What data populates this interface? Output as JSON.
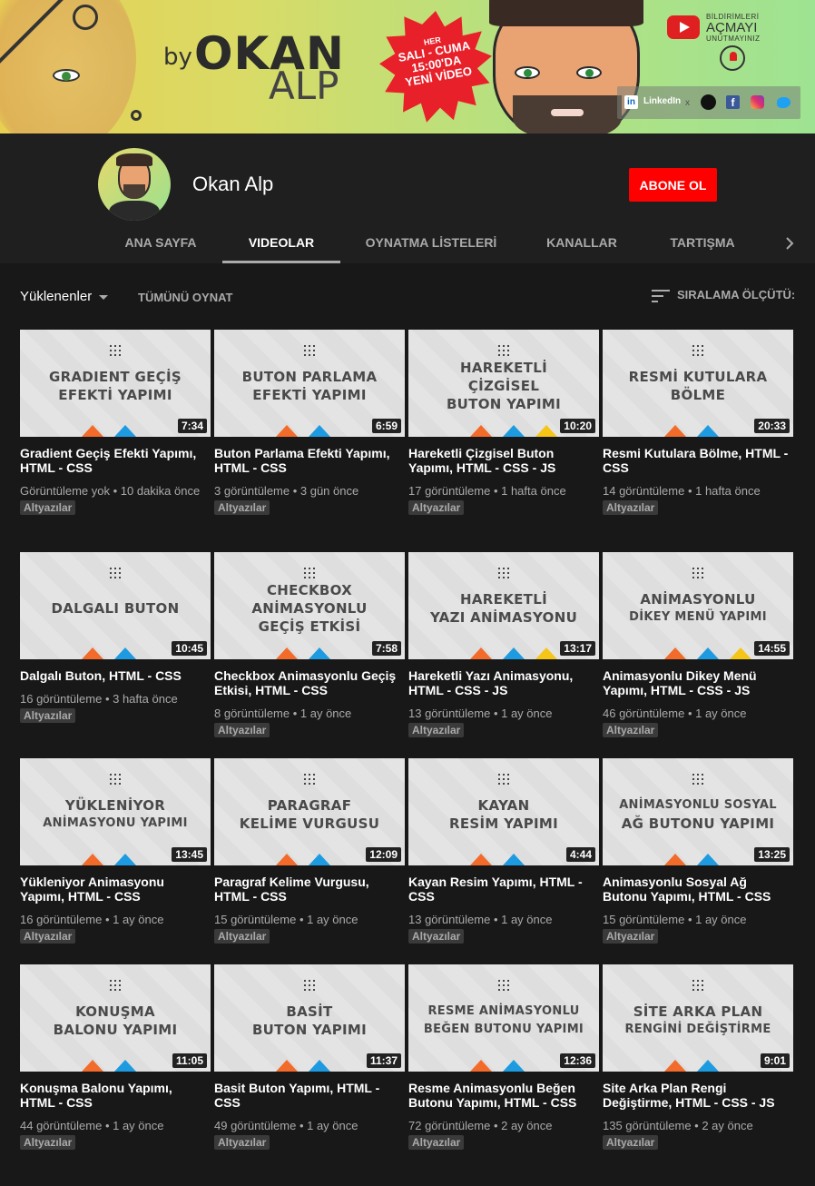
{
  "banner": {
    "by": "by",
    "name_first": "OKAN",
    "name_last": "ALP",
    "promo": [
      "HER",
      "SALI - CUMA",
      "15:00'DA",
      "YENİ VİDEO"
    ],
    "notify_top": "BİLDİRİMLERİ",
    "notify_mid": "AÇMAYI",
    "notify_bottom": "UNUTMAYINIZ",
    "social": {
      "linkedin": "LinkedIn",
      "x": "x"
    }
  },
  "channel": {
    "name": "Okan Alp",
    "subscribe_label": "ABONE OL"
  },
  "tabs": [
    {
      "label": "ANA SAYFA",
      "active": false
    },
    {
      "label": "VIDEOLAR",
      "active": true
    },
    {
      "label": "OYNATMA LİSTELERİ",
      "active": false
    },
    {
      "label": "KANALLAR",
      "active": false
    },
    {
      "label": "TARTIŞMA",
      "active": false
    }
  ],
  "filter": {
    "uploads_label": "Yüklenenler",
    "play_all_label": "TÜMÜNÜ OYNAT",
    "sort_label": "SIRALAMA ÖLÇÜTÜ:"
  },
  "videos": [
    {
      "thumb": [
        "GRADIENT GEÇİŞ",
        "EFEKTİ YAPIMI"
      ],
      "duration": "7:34",
      "title": "Gradient Geçiş Efekti Yapımı, HTML - CSS",
      "meta": "Görüntüleme yok • 10 dakika önce",
      "badge": "Altyazılar",
      "yellow": false
    },
    {
      "thumb": [
        "BUTON PARLAMA",
        "EFEKTİ YAPIMI"
      ],
      "duration": "6:59",
      "title": "Buton Parlama Efekti Yapımı, HTML - CSS",
      "meta": "3 görüntüleme • 3 gün önce",
      "badge": "Altyazılar",
      "yellow": false
    },
    {
      "thumb": [
        "HAREKETLİ",
        "ÇİZGİSEL",
        "BUTON YAPIMI"
      ],
      "duration": "10:20",
      "title": "Hareketli Çizgisel Buton Yapımı, HTML - CSS - JS",
      "meta": "17 görüntüleme • 1 hafta önce",
      "badge": "Altyazılar",
      "yellow": true
    },
    {
      "thumb": [
        "RESMİ KUTULARA",
        "BÖLME"
      ],
      "duration": "20:33",
      "title": "Resmi Kutulara Bölme, HTML - CSS",
      "meta": "14 görüntüleme • 1 hafta önce",
      "badge": "Altyazılar",
      "yellow": false
    },
    {
      "thumb": [
        "DALGALI BUTON"
      ],
      "duration": "10:45",
      "title": "Dalgalı Buton, HTML - CSS",
      "meta": "16 görüntüleme • 3 hafta önce",
      "badge": "Altyazılar",
      "yellow": false
    },
    {
      "thumb": [
        "CHECKBOX",
        "ANİMASYONLU",
        "GEÇİŞ ETKİSİ"
      ],
      "duration": "7:58",
      "title": "Checkbox Animasyonlu Geçiş Etkisi, HTML - CSS",
      "meta": "8 görüntüleme • 1 ay önce",
      "badge": "Altyazılar",
      "yellow": false
    },
    {
      "thumb": [
        "HAREKETLİ",
        "YAZI ANİMASYONU"
      ],
      "duration": "13:17",
      "title": "Hareketli Yazı Animasyonu, HTML - CSS - JS",
      "meta": "13 görüntüleme • 1 ay önce",
      "badge": "Altyazılar",
      "yellow": true
    },
    {
      "thumb": [
        "ANİMASYONLU",
        "DİKEY MENÜ YAPIMI"
      ],
      "duration": "14:55",
      "title": "Animasyonlu Dikey Menü Yapımı, HTML - CSS - JS",
      "meta": "46 görüntüleme • 1 ay önce",
      "badge": "Altyazılar",
      "yellow": true
    },
    {
      "thumb": [
        "YÜKLENİYOR",
        "ANİMASYONU YAPIMI"
      ],
      "duration": "13:45",
      "title": "Yükleniyor Animasyonu Yapımı, HTML - CSS",
      "meta": "16 görüntüleme • 1 ay önce",
      "badge": "Altyazılar",
      "yellow": false
    },
    {
      "thumb": [
        "PARAGRAF",
        "KELİME VURGUSU"
      ],
      "duration": "12:09",
      "title": "Paragraf Kelime Vurgusu, HTML - CSS",
      "meta": "15 görüntüleme • 1 ay önce",
      "badge": "Altyazılar",
      "yellow": false
    },
    {
      "thumb": [
        "KAYAN",
        "RESİM YAPIMI"
      ],
      "duration": "4:44",
      "title": "Kayan Resim Yapımı, HTML - CSS",
      "meta": "13 görüntüleme • 1 ay önce",
      "badge": "Altyazılar",
      "yellow": false
    },
    {
      "thumb": [
        "ANİMASYONLU SOSYAL",
        "AĞ BUTONU YAPIMI"
      ],
      "duration": "13:25",
      "title": "Animasyonlu Sosyal Ağ Butonu Yapımı, HTML - CSS",
      "meta": "15 görüntüleme • 1 ay önce",
      "badge": "Altyazılar",
      "yellow": false
    },
    {
      "thumb": [
        "KONUŞMA",
        "BALONU YAPIMI"
      ],
      "duration": "11:05",
      "title": "Konuşma Balonu Yapımı, HTML - CSS",
      "meta": "44 görüntüleme • 1 ay önce",
      "badge": "Altyazılar",
      "yellow": false
    },
    {
      "thumb": [
        "BASİT",
        "BUTON YAPIMI"
      ],
      "duration": "11:37",
      "title": "Basit Buton Yapımı, HTML - CSS",
      "meta": "49 görüntüleme • 1 ay önce",
      "badge": "Altyazılar",
      "yellow": false
    },
    {
      "thumb": [
        "RESME ANİMASYONLU",
        "BEĞEN BUTONU YAPIMI"
      ],
      "duration": "12:36",
      "title": "Resme Animasyonlu Beğen Butonu Yapımı, HTML - CSS",
      "meta": "72 görüntüleme • 2 ay önce",
      "badge": "Altyazılar",
      "yellow": false
    },
    {
      "thumb": [
        "SİTE ARKA PLAN",
        "RENGİNİ DEĞİŞTİRME"
      ],
      "duration": "9:01",
      "title": "Site Arka Plan Rengi Değiştirme, HTML - CSS - JS",
      "meta": "135 görüntüleme • 2 ay önce",
      "badge": "Altyazılar",
      "yellow": false
    }
  ],
  "colors": {
    "subscribe": "#ff0000",
    "accent_orange": "#f26b2a",
    "accent_blue": "#1e9be0",
    "accent_yellow": "#f5c518"
  }
}
